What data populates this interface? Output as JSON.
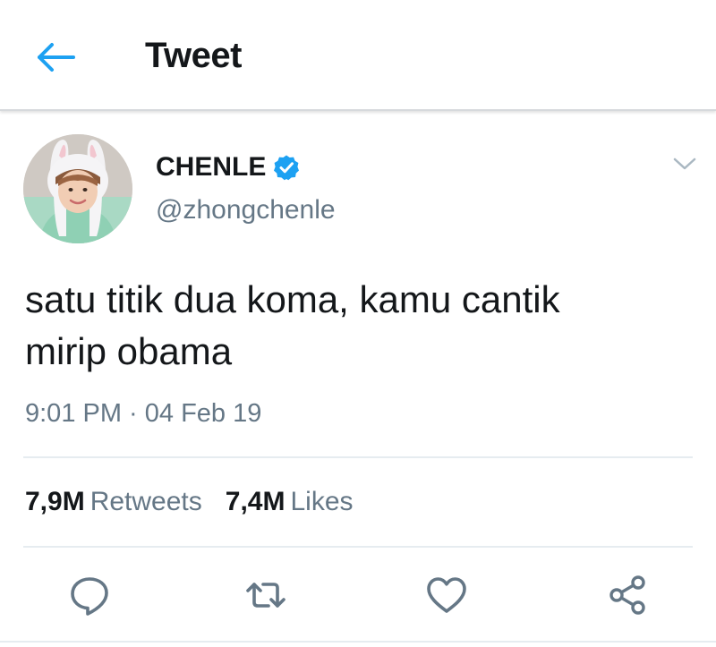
{
  "header": {
    "title": "Tweet",
    "back_icon": "arrow-left-icon",
    "accent_color": "#1da1f2"
  },
  "tweet": {
    "author": {
      "display_name": "CHENLE",
      "handle": "@zhongchenle",
      "verified": true,
      "verified_color": "#1da1f2"
    },
    "text_lines": [
      "satu titik dua koma, kamu cantik",
      "mirip obama"
    ],
    "timestamp": "9:01 PM · 04 Feb 19",
    "stats": {
      "retweets_count": "7,9M",
      "retweets_label": "Retweets",
      "likes_count": "7,4M",
      "likes_label": "Likes"
    },
    "actions": [
      {
        "icon": "reply-icon"
      },
      {
        "icon": "retweet-icon"
      },
      {
        "icon": "heart-icon"
      },
      {
        "icon": "share-icon"
      }
    ]
  }
}
